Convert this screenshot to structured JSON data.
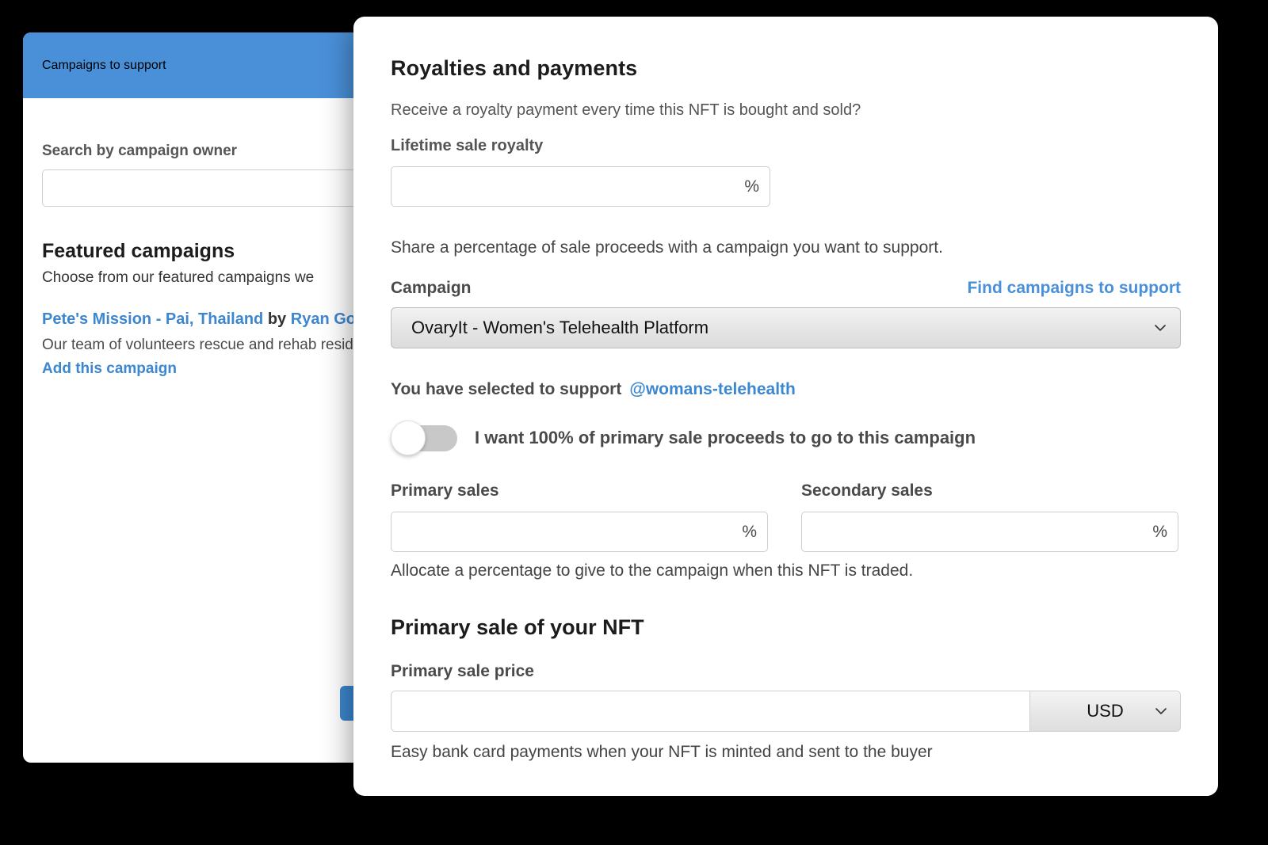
{
  "back_panel": {
    "header_title": "Campaigns to support",
    "search_label": "Search by campaign owner",
    "search_value": "",
    "search_placeholder": "",
    "featured_title": "Featured campaigns",
    "featured_subtitle": "Choose from our featured campaigns we",
    "campaign": {
      "name": "Pete's Mission - Pai, Thailand",
      "by_word": "by",
      "owner": "Ryan Go",
      "description": "Our team of volunteers rescue and rehab resid...",
      "add_link": "Add this campaign"
    }
  },
  "modal": {
    "title": "Royalties and payments",
    "lead": "Receive a royalty payment every time this NFT is bought and sold?",
    "lifetime_royalty_label": "Lifetime sale royalty",
    "lifetime_royalty_value": "",
    "percent_sign": "%",
    "share_note": "Share a percentage of sale proceeds with a campaign you want to support.",
    "campaign_label": "Campaign",
    "find_campaigns_link": "Find campaigns to support",
    "campaign_selected": "OvaryIt - Women's Telehealth Platform",
    "selected_prefix": "You have selected to support",
    "selected_handle": "@womans-telehealth",
    "toggle_label": "I want 100% of primary sale proceeds to go to this campaign",
    "toggle_state": "off",
    "primary_sales_label": "Primary sales",
    "primary_sales_value": "",
    "secondary_sales_label": "Secondary sales",
    "secondary_sales_value": "",
    "allocate_note": "Allocate a percentage to give to the campaign when this NFT is traded.",
    "primary_sale_section_title": "Primary sale of your NFT",
    "primary_sale_price_label": "Primary sale price",
    "primary_sale_price_value": "",
    "currency_selected": "USD",
    "easy_note": "Easy bank card payments when your NFT is minted and sent to the buyer"
  },
  "colors": {
    "brand_blue": "#4a90d9",
    "link_blue": "#3c87d0",
    "background": "#000000",
    "panel_white": "#ffffff"
  }
}
